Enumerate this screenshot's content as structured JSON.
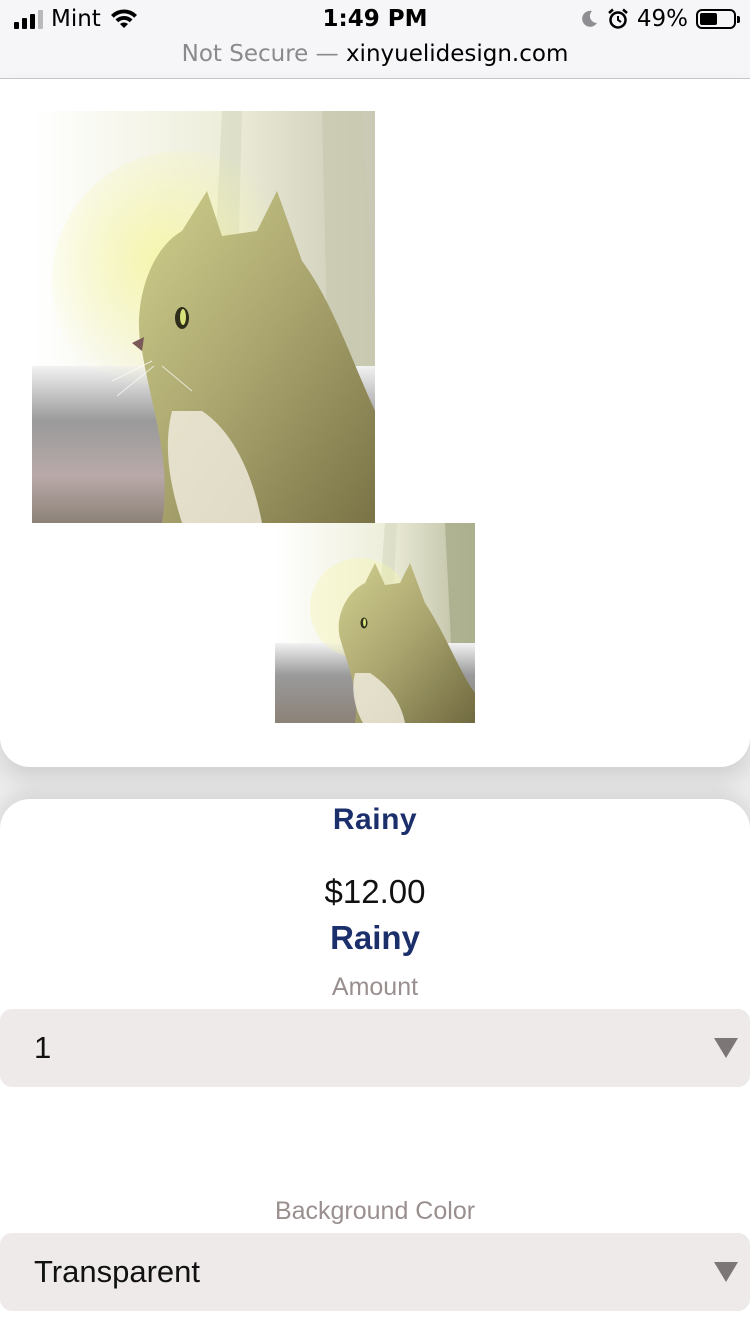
{
  "status_bar": {
    "carrier": "Mint",
    "time": "1:49 PM",
    "battery_percent": "49%",
    "icons": [
      "signal-icon",
      "wifi-icon",
      "moon-icon",
      "alarm-icon",
      "battery-icon"
    ]
  },
  "browser": {
    "security_label": "Not Secure —",
    "domain": "xinyuelidesign.com"
  },
  "gallery": {
    "images": [
      "cat-painting-main",
      "cat-painting-thumbnail"
    ]
  },
  "product": {
    "title": "Rainy",
    "price": "$12.00",
    "variant_name": "Rainy",
    "amount_label": "Amount",
    "amount_value": "1",
    "background_label": "Background Color",
    "background_value": "Transparent"
  },
  "colors": {
    "title_navy": "#1b2f6b",
    "label_gray": "#9a8f8f",
    "select_bg": "#eeeaea",
    "caret": "#7d7676"
  }
}
